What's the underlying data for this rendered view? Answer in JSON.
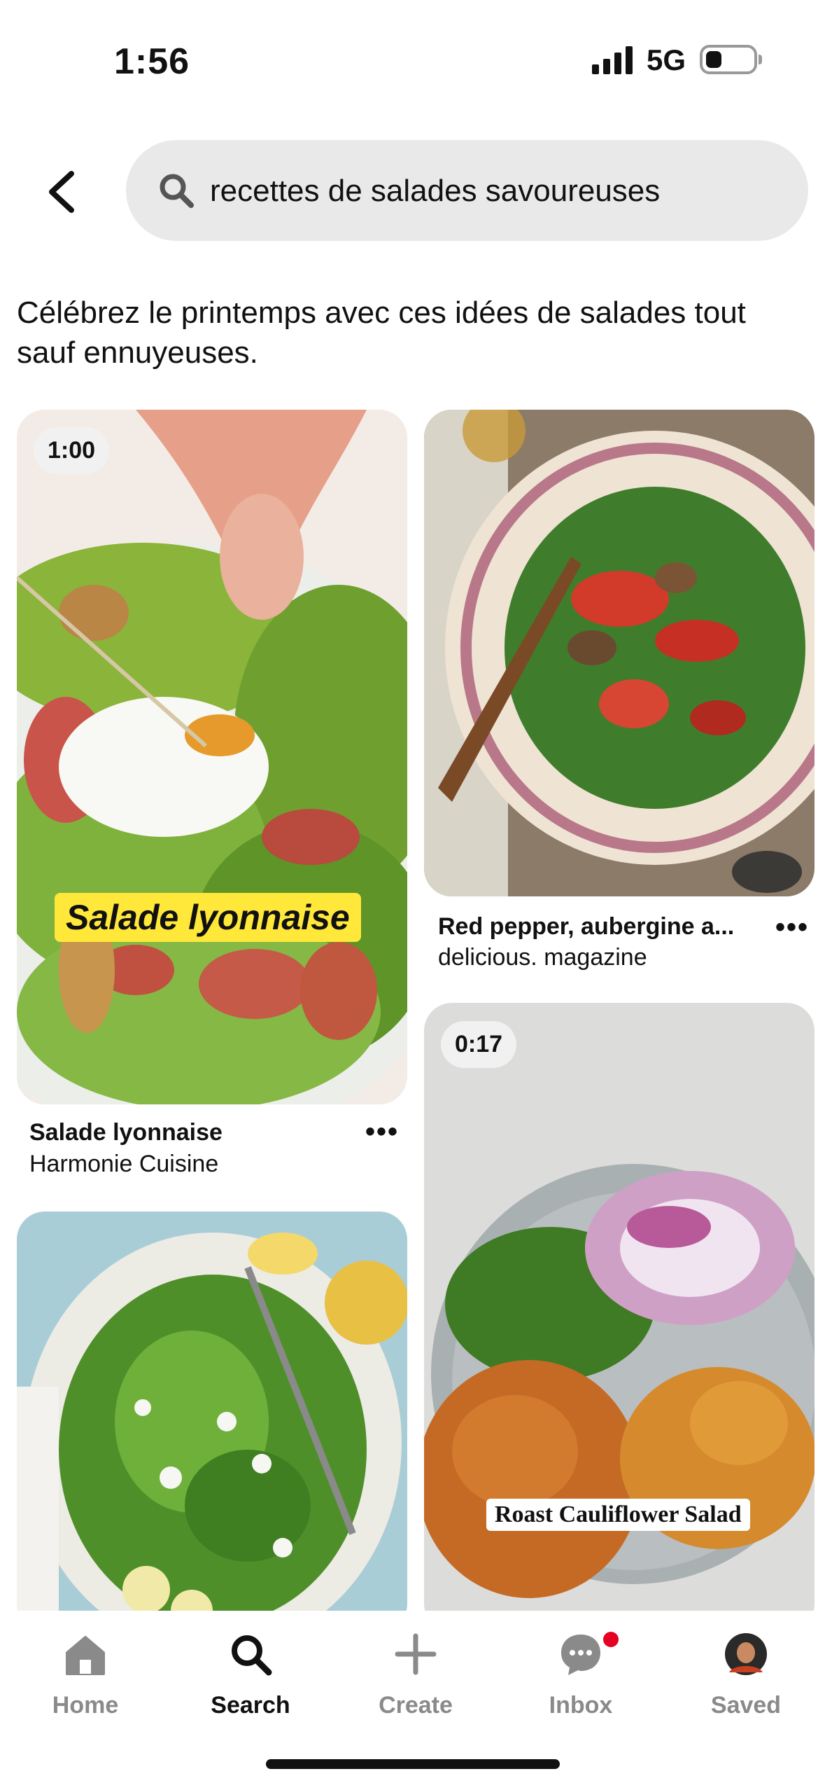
{
  "status_bar": {
    "time": "1:56",
    "network": "5G",
    "battery_percent": 25
  },
  "search": {
    "query": "recettes de salades savoureuses"
  },
  "intro_text": "Célébrez le printemps avec ces idées de salades tout sauf ennuyeuses.",
  "pins": [
    {
      "duration": "1:00",
      "overlay": "Salade lyonnaise",
      "title": "Salade lyonnaise",
      "source": "Harmonie Cuisine"
    },
    {
      "title": "Red pepper, aubergine a...",
      "source": "delicious. magazine"
    },
    {
      "duration": "0:17",
      "overlay": "Roast Cauliflower Salad"
    }
  ],
  "nav": [
    {
      "label": "Home",
      "icon": "home-icon"
    },
    {
      "label": "Search",
      "icon": "search-icon",
      "active": true
    },
    {
      "label": "Create",
      "icon": "plus-icon"
    },
    {
      "label": "Inbox",
      "icon": "chat-icon",
      "badge": true
    },
    {
      "label": "Saved",
      "icon": "avatar"
    }
  ]
}
